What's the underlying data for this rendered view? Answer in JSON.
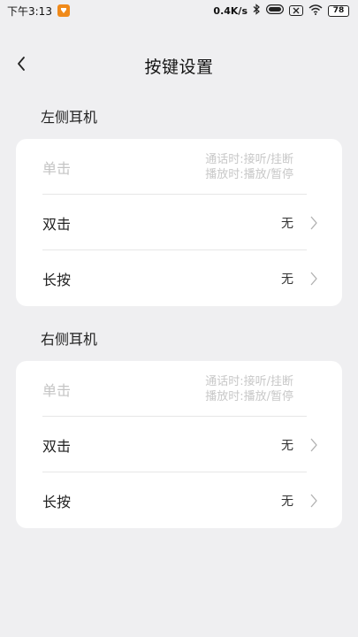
{
  "status_bar": {
    "time": "下午3:13",
    "net_speed": "0.4K/s",
    "battery": "78",
    "icons": [
      "app-icon",
      "bluetooth-icon",
      "hd-icon",
      "sim-off-icon",
      "wifi-icon",
      "battery-icon"
    ]
  },
  "header": {
    "title": "按键设置",
    "back_icon": "chevron-left-icon"
  },
  "sections": [
    {
      "title": "左侧耳机",
      "rows": [
        {
          "label": "单击",
          "desc_line1": "通话时:接听/挂断",
          "desc_line2": "播放时:播放/暂停",
          "disabled": true
        },
        {
          "label": "双击",
          "value": "无"
        },
        {
          "label": "长按",
          "value": "无"
        }
      ]
    },
    {
      "title": "右侧耳机",
      "rows": [
        {
          "label": "单击",
          "desc_line1": "通话时:接听/挂断",
          "desc_line2": "播放时:播放/暂停",
          "disabled": true
        },
        {
          "label": "双击",
          "value": "无"
        },
        {
          "label": "长按",
          "value": "无"
        }
      ]
    }
  ],
  "colors": {
    "background": "#efeff1",
    "card": "#ffffff",
    "disabled_text": "#c4c4c4",
    "app_icon": "#f08a1a"
  }
}
